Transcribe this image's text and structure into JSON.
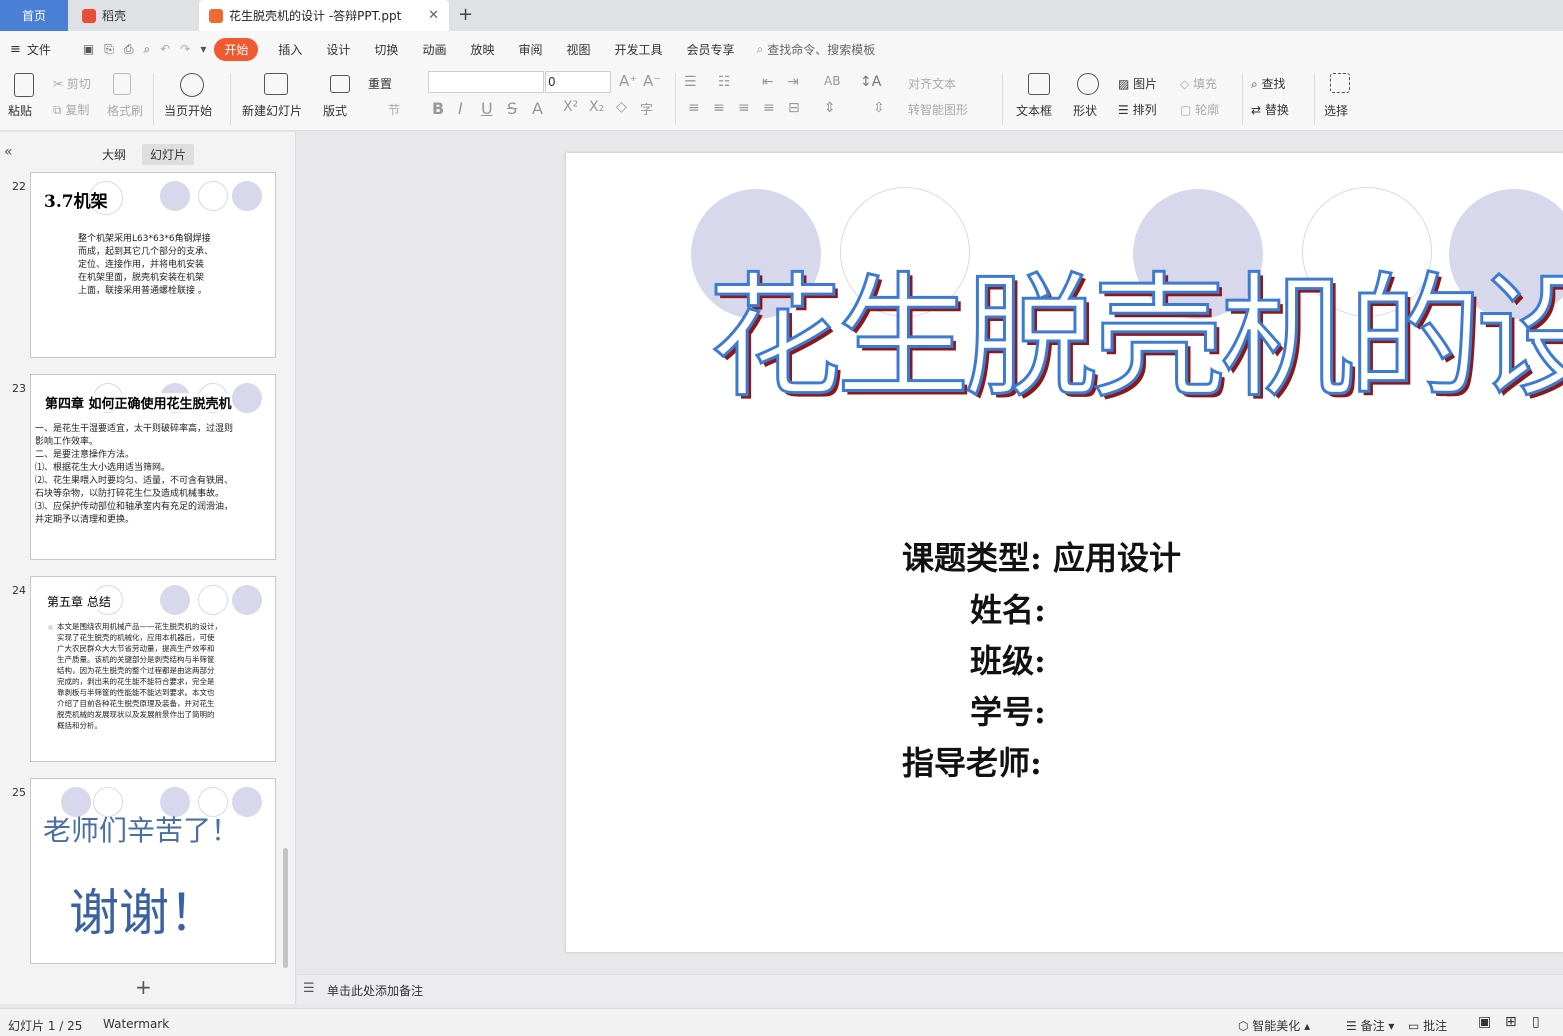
{
  "tabs": {
    "home": "首页",
    "daoke": "稻壳",
    "document": "花生脱壳机的设计 -答辩PPT.ppt"
  },
  "menu": {
    "file": "文件",
    "items": [
      "开始",
      "插入",
      "设计",
      "切换",
      "动画",
      "放映",
      "审阅",
      "视图",
      "开发工具",
      "会员专享"
    ],
    "search": "查找命令、搜索模板"
  },
  "toolbar": {
    "paste": "粘贴",
    "cut": "剪切",
    "copy": "复制",
    "format_painter": "格式刷",
    "play_current": "当页开始",
    "new_slide": "新建幻灯片",
    "layout": "版式",
    "reset": "重置",
    "section": "节",
    "font_size": "0",
    "align_text": "对齐文本",
    "smart_shape": "转智能图形",
    "textbox": "文本框",
    "shape": "形状",
    "picture": "图片",
    "arrange": "排列",
    "fill": "填充",
    "outline": "轮廓",
    "find": "查找",
    "replace": "替换",
    "select": "选择"
  },
  "panel": {
    "outline_tab": "大纲",
    "slides_tab": "幻灯片"
  },
  "thumbnails": [
    {
      "num": "22",
      "title": "3.7机架",
      "body": [
        "整个机架采用L63*63*6角钢焊接",
        "而成，起到其它几个部分的支承、",
        "定位、连接作用，并将电机安装",
        "在机架里面，脱壳机安装在机架",
        "上面，联接采用普通螺栓联接 。"
      ]
    },
    {
      "num": "23",
      "title": "第四章 如何正确使用花生脱壳机",
      "body": [
        "一、是花生干湿要适宜，太干则破碎率高，过湿则",
        "影响工作效率。",
        "二、是要注意操作方法。",
        "⑴、根据花生大小选用适当筛网。",
        "⑵、花生果喂入时要均匀、适量，不可含有铁屑、",
        "石块等杂物，以防打碎花生仁及造成机械事故。",
        "⑶、应保护传动部位和轴承室内有充足的润滑油，",
        "并定期予以清理和更换。"
      ]
    },
    {
      "num": "24",
      "title": "第五章 总结",
      "body": [
        "本文是围绕农用机械产品——花生脱壳机的设计，",
        "实现了花生脱壳的机械化，应用本机器后，可使",
        "广大农民群众大大节省劳动量，提高生产效率和",
        "生产质量。该机的关键部分是剥壳结构与半筛筐",
        "结构，因为花生脱壳的整个过程都是由这两部分",
        "完成的，剥出来的花生能不能符合要求，完全是",
        "靠剥板与半筛筐的性能能不能达到要求。本文也",
        "介绍了目前各种花生脱壳原理及装备，并对花生",
        "脱壳机械的发展现状以及发展前景作出了简明的",
        "概括和分析。"
      ]
    },
    {
      "num": "25",
      "title": "老师们辛苦了！",
      "body": [
        "谢谢！"
      ]
    }
  ],
  "slide": {
    "title": "花生脱壳机的设计",
    "lines": [
      "课题类型: 应用设计",
      "姓名:",
      "班级:",
      "学号:",
      "指导老师:"
    ]
  },
  "notes_placeholder": "单击此处添加备注",
  "status": {
    "slide_counter": "幻灯片 1 / 25",
    "theme": "Watermark",
    "beautify": "智能美化",
    "notes": "备注",
    "comments": "批注"
  },
  "colors": {
    "accent": "#f05a31",
    "home_tab": "#4a7fd6",
    "title_stroke": "#3d7bd2",
    "title_shadow": "#8a1a1a",
    "circle": "#d8d8ec"
  }
}
